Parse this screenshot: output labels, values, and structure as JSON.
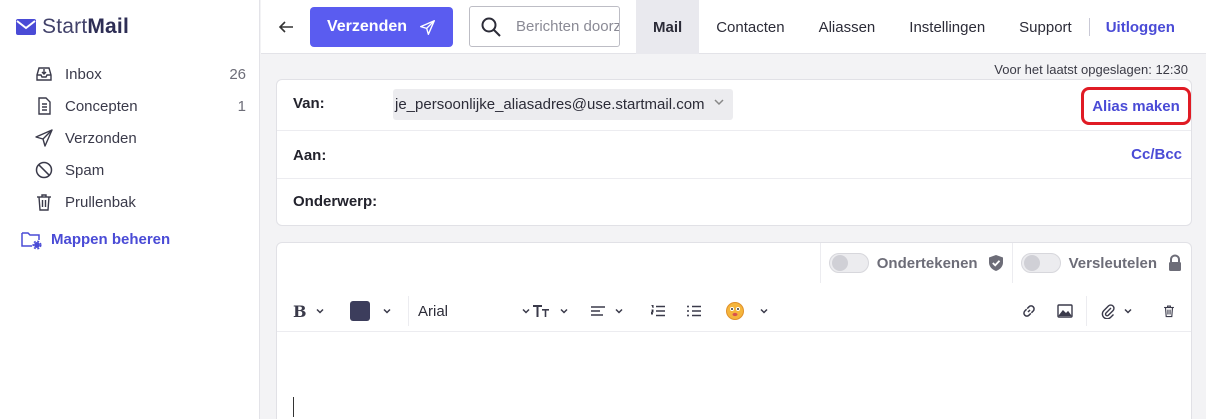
{
  "app": {
    "logo_text_light": "Start",
    "logo_text_bold": "Mail",
    "accent_color": "#5a5cf0",
    "link_color": "#4a4bd6",
    "highlight_color": "#e01b24"
  },
  "sidebar": {
    "items": [
      {
        "label": "Inbox",
        "count": "26",
        "icon": "inbox-icon"
      },
      {
        "label": "Concepten",
        "count": "1",
        "icon": "document-icon"
      },
      {
        "label": "Verzonden",
        "count": "",
        "icon": "send-icon"
      },
      {
        "label": "Spam",
        "count": "",
        "icon": "block-icon"
      },
      {
        "label": "Prullenbak",
        "count": "",
        "icon": "trash-icon"
      }
    ],
    "manage_folders": "Mappen beheren"
  },
  "topbar": {
    "back_icon": "arrow-left-icon",
    "send_label": "Verzenden",
    "search_placeholder": "Berichten doorzoeken",
    "tabs": [
      {
        "label": "Mail",
        "active": true
      },
      {
        "label": "Contacten",
        "active": false
      },
      {
        "label": "Aliassen",
        "active": false
      },
      {
        "label": "Instellingen",
        "active": false
      },
      {
        "label": "Support",
        "active": false
      }
    ],
    "logout_label": "Uitloggen"
  },
  "compose": {
    "saved_status": "Voor het laatst opgeslagen: 12:30",
    "from_label": "Van:",
    "from_value": "je_persoonlijke_aliasadres@use.startmail.com",
    "alias_button": "Alias maken",
    "to_label": "Aan:",
    "ccbcc_label": "Cc/Bcc",
    "subject_label": "Onderwerp:",
    "sign_label": "Ondertekenen",
    "encrypt_label": "Versleutelen",
    "font_name": "Arial"
  }
}
